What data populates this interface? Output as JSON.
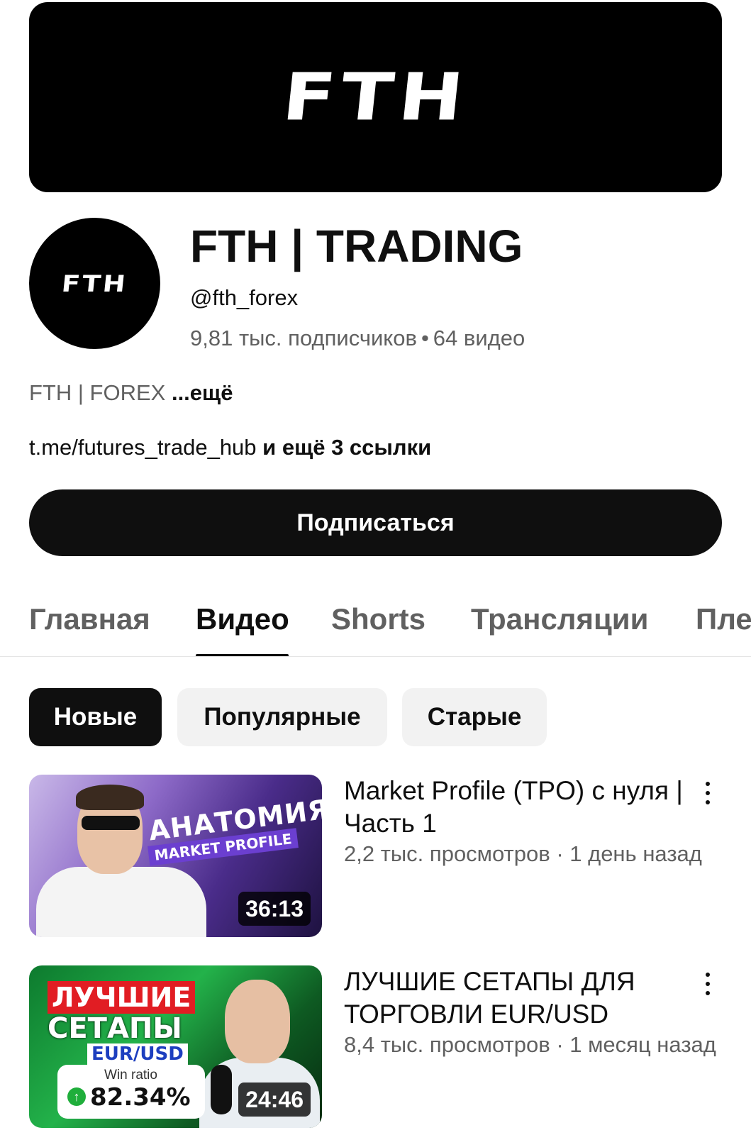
{
  "banner": {
    "logo_text": "FTH"
  },
  "avatar": {
    "logo_text": "FTH"
  },
  "channel": {
    "title": "FTH | TRADING",
    "handle": "@fth_forex",
    "subscribers": "9,81 тыс. подписчиков",
    "separator": "•",
    "video_count": "64 видео",
    "description": "FTH | FOREX",
    "description_more": "...ещё",
    "link_url": "t.me/futures_trade_hub",
    "link_more": " и ещё 3 ссылки"
  },
  "subscribe_label": "Подписаться",
  "tabs": [
    {
      "label": "Главная",
      "active": false
    },
    {
      "label": "Видео",
      "active": true
    },
    {
      "label": "Shorts",
      "active": false
    },
    {
      "label": "Трансляции",
      "active": false
    },
    {
      "label": "Плейлисты",
      "active": false
    }
  ],
  "chips": [
    {
      "label": "Новые",
      "active": true
    },
    {
      "label": "Популярные",
      "active": false
    },
    {
      "label": "Старые",
      "active": false
    }
  ],
  "videos": [
    {
      "title": "Market Profile (TPO) с нуля | Часть 1",
      "meta": "2,2 тыс. просмотров · 1 день назад",
      "duration": "36:13",
      "thumb_text_1": "АНАТОМИЯ",
      "thumb_text_2": "MARKET PROFILE"
    },
    {
      "title": "ЛУЧШИЕ СЕТАПЫ ДЛЯ ТОРГОВЛИ EUR/USD",
      "meta": "8,4 тыс. просмотров · 1 месяц назад",
      "duration": "24:46",
      "thumb_text_1": "ЛУЧШИЕ",
      "thumb_text_2": "СЕТАПЫ",
      "thumb_text_3": "EUR/USD",
      "thumb_card_label": "Win ratio",
      "thumb_card_value": "82.34%"
    }
  ],
  "colors": {
    "primary_text": "#0f0f0f",
    "secondary_text": "#606060",
    "chip_bg": "#f2f2f2"
  }
}
